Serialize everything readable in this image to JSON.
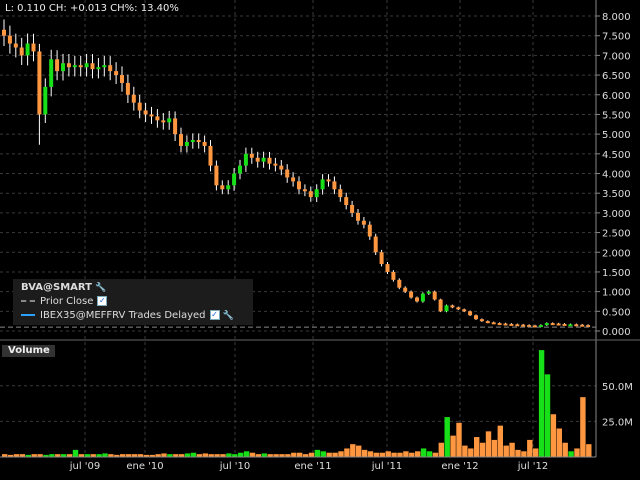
{
  "header": {
    "text": "L: 0.110 CH: +0.013 CH%: 13.40%"
  },
  "legend": {
    "symbol": "BVA@SMART",
    "items": [
      "Prior Close",
      "IBEX35@MEFFRV Trades Delayed"
    ]
  },
  "volume_panel": {
    "label": "Volume"
  },
  "colors": {
    "up": "#18e018",
    "down": "#ff9640",
    "wick": "#ffffff",
    "grid": "#3a3a3a",
    "index_line": "#2aa0ff"
  },
  "chart_data": [
    {
      "type": "candlestick",
      "title": "BVA@SMART",
      "ylim": [
        0,
        8
      ],
      "y_ticks": [
        "8.000",
        "7.500",
        "7.000",
        "6.500",
        "6.000",
        "5.500",
        "5.000",
        "4.500",
        "4.000",
        "3.500",
        "3.000",
        "2.500",
        "2.000",
        "1.500",
        "1.000",
        "0.500",
        "0.000"
      ],
      "x_ticks": [
        "jul '09",
        "ene '10",
        "jul '10",
        "ene '11",
        "jul '11",
        "ene '12",
        "jul '12"
      ],
      "prior_close": 0.097,
      "closes": [
        7.5,
        7.3,
        7.2,
        7.0,
        7.3,
        7.1,
        5.5,
        6.2,
        6.9,
        6.6,
        6.8,
        6.7,
        6.75,
        6.7,
        6.8,
        6.65,
        6.7,
        6.75,
        6.6,
        6.5,
        6.3,
        6.0,
        5.8,
        5.6,
        5.5,
        5.45,
        5.35,
        5.3,
        5.4,
        5.0,
        4.7,
        4.8,
        4.85,
        4.8,
        4.7,
        4.2,
        3.7,
        3.6,
        3.7,
        4.0,
        4.2,
        4.5,
        4.4,
        4.3,
        4.4,
        4.25,
        4.2,
        4.1,
        3.9,
        3.8,
        3.6,
        3.55,
        3.4,
        3.6,
        3.85,
        3.8,
        3.6,
        3.4,
        3.2,
        3.0,
        2.8,
        2.7,
        2.4,
        2.0,
        1.7,
        1.5,
        1.3,
        1.1,
        1.0,
        0.85,
        0.75,
        0.95,
        1.0,
        0.8,
        0.5,
        0.65,
        0.6,
        0.55,
        0.5,
        0.4,
        0.3,
        0.25,
        0.22,
        0.2,
        0.19,
        0.18,
        0.17,
        0.16,
        0.15,
        0.14,
        0.13,
        0.15,
        0.2,
        0.19,
        0.18,
        0.17,
        0.17,
        0.16,
        0.15,
        0.11
      ]
    },
    {
      "type": "bar",
      "title": "Volume",
      "ylim": [
        0,
        80
      ],
      "y_ticks": [
        "50.0M",
        "25.0M"
      ],
      "unit": "M",
      "values": [
        2,
        1.5,
        2,
        2,
        1.5,
        2,
        2,
        1.5,
        2,
        2,
        2,
        2,
        5,
        2,
        2,
        2,
        2,
        2.5,
        2,
        1.5,
        2,
        2,
        2,
        2,
        1.5,
        1.5,
        2,
        2.5,
        2,
        2,
        2,
        2.5,
        3,
        2,
        2.5,
        2,
        2,
        2,
        2.5,
        2,
        3,
        4,
        3,
        2,
        2.5,
        2,
        2,
        2,
        2,
        3,
        3,
        2,
        3,
        5,
        4,
        3,
        3,
        4,
        6,
        9,
        8,
        5,
        4,
        3,
        3,
        4,
        3,
        3,
        4,
        3,
        4,
        6,
        4,
        3,
        10,
        28,
        15,
        24,
        8,
        6,
        14,
        10,
        18,
        12,
        22,
        8,
        10,
        5,
        4,
        12,
        6,
        75,
        58,
        30,
        20,
        10,
        4,
        6,
        42,
        9
      ]
    }
  ]
}
